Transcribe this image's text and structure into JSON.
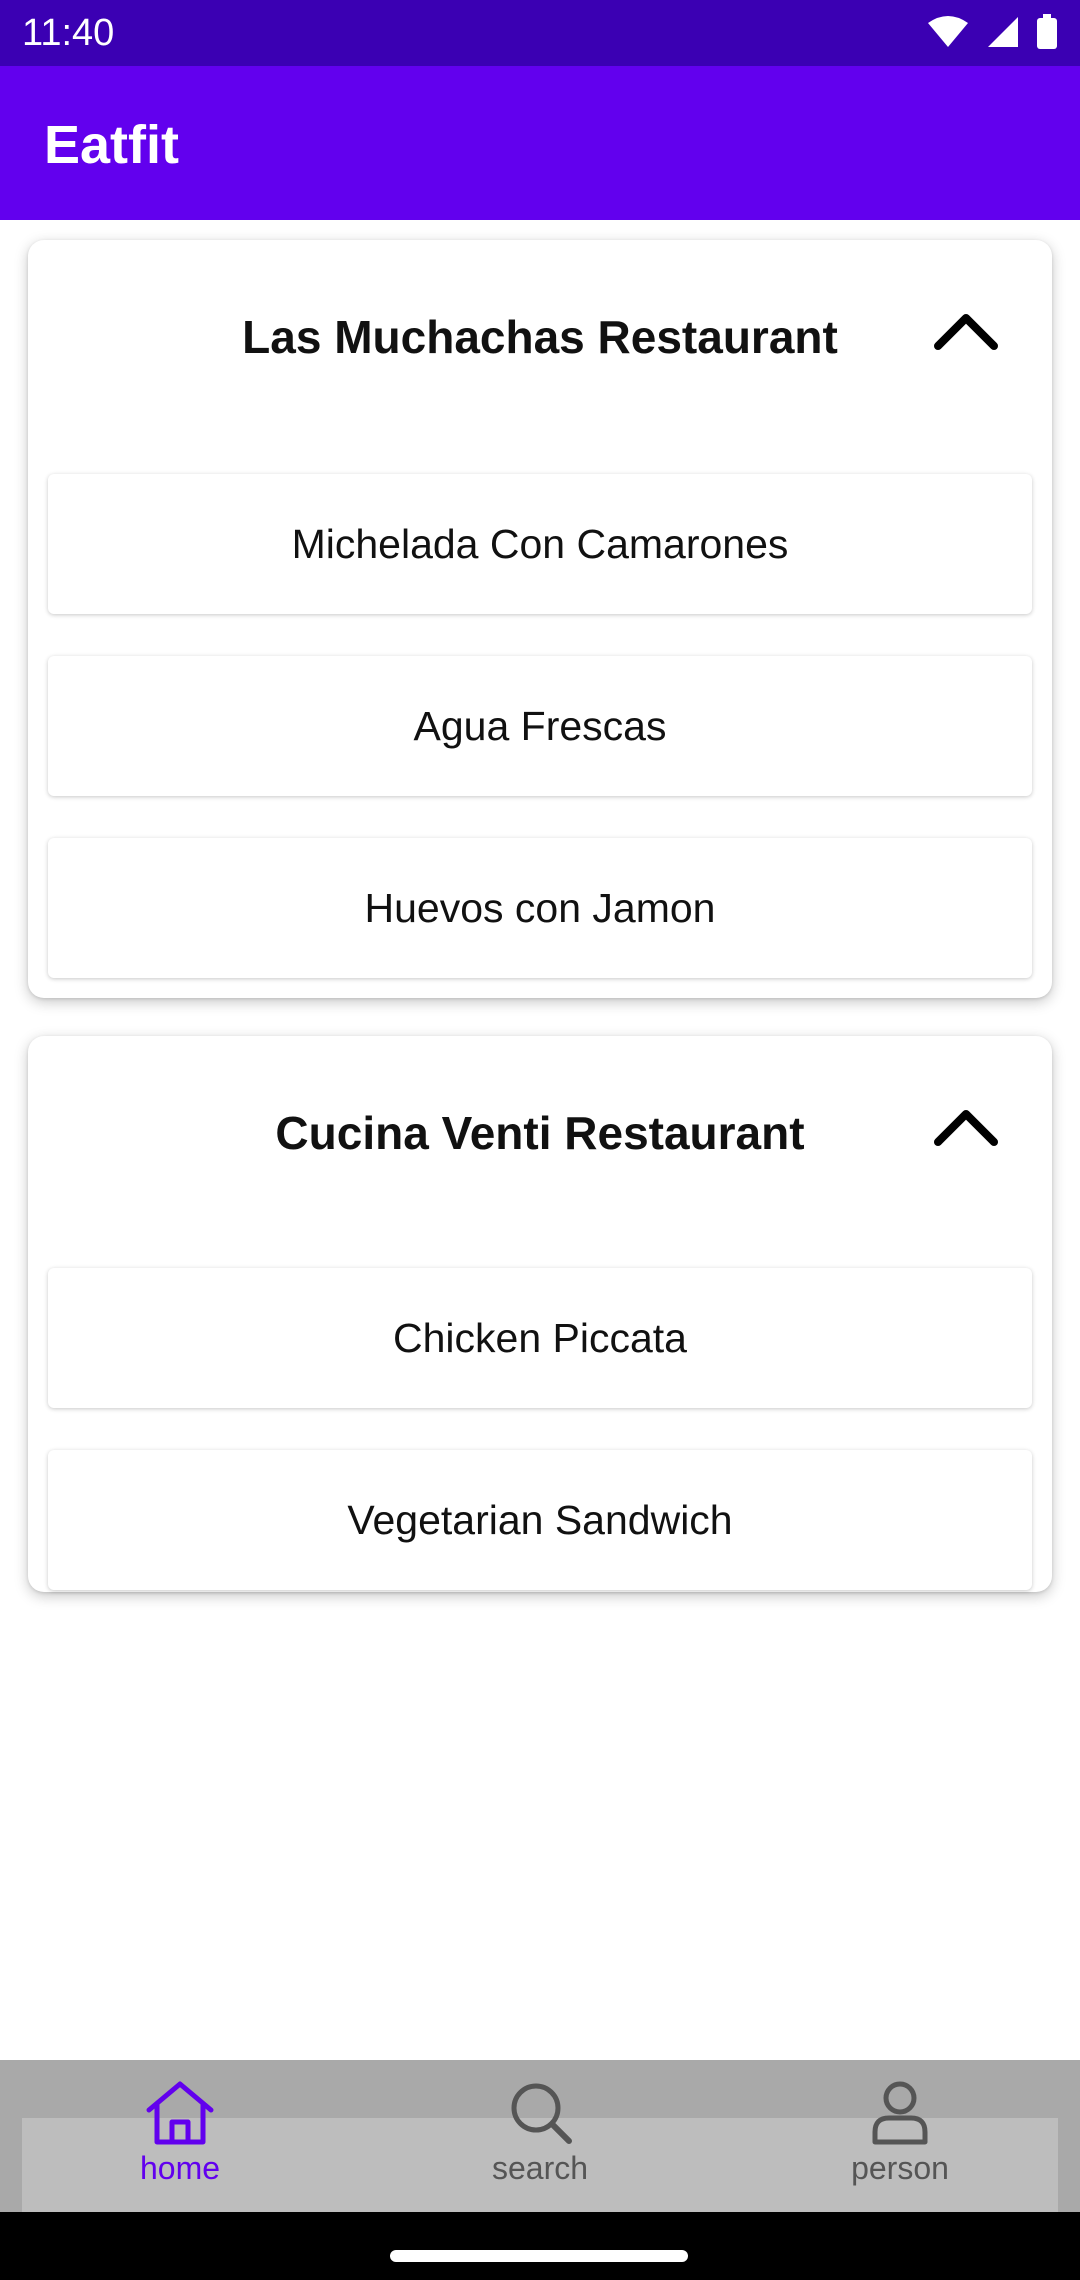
{
  "status": {
    "time": "11:40"
  },
  "appbar": {
    "title": "Eatfit"
  },
  "restaurants": [
    {
      "name": "Las Muchachas Restaurant",
      "items": [
        "Michelada Con Camarones",
        "Agua Frescas",
        "Huevos con Jamon"
      ]
    },
    {
      "name": "Cucina Venti Restaurant",
      "items": [
        "Chicken Piccata",
        "Vegetarian Sandwich"
      ]
    }
  ],
  "nav": {
    "home": "home",
    "search": "search",
    "person": "person"
  },
  "colors": {
    "primary": "#6200ee",
    "status_bar": "#3b00b3"
  },
  "icons": [
    "wifi-icon",
    "signal-icon",
    "battery-icon",
    "chevron-up-icon",
    "home-icon",
    "search-icon",
    "person-icon"
  ]
}
